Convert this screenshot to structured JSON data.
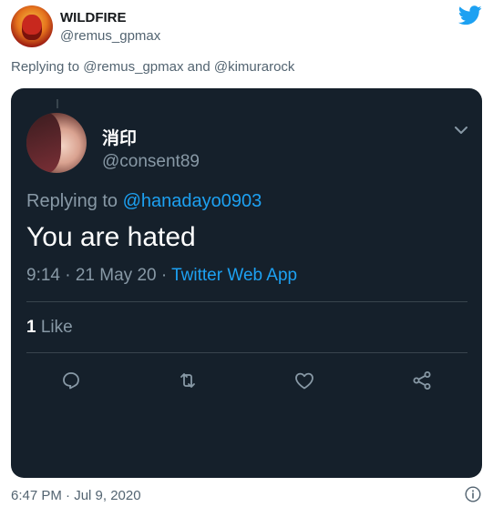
{
  "outer": {
    "name": "WILDFIRE",
    "handle": "@remus_gpmax",
    "replying": "Replying to @remus_gpmax and @kimurarock",
    "timestamp": "6:47 PM · Jul 9, 2020"
  },
  "embedded": {
    "name": "消印",
    "handle": "@consent89",
    "replying_prefix": "Replying to ",
    "replying_mention": "@hanadayo0903",
    "text": "You are hated",
    "time": "9:14 · 21 May 20 · ",
    "source": "Twitter Web App",
    "likes_count": "1",
    "likes_label": " Like"
  },
  "colors": {
    "card_bg": "#15202b",
    "accent": "#1da1f2",
    "muted": "#8899a6",
    "divider": "#38444d"
  },
  "icons": [
    "twitter-bird-icon",
    "chevron-down-icon",
    "reply-icon",
    "retweet-icon",
    "like-icon",
    "share-icon",
    "info-icon"
  ]
}
